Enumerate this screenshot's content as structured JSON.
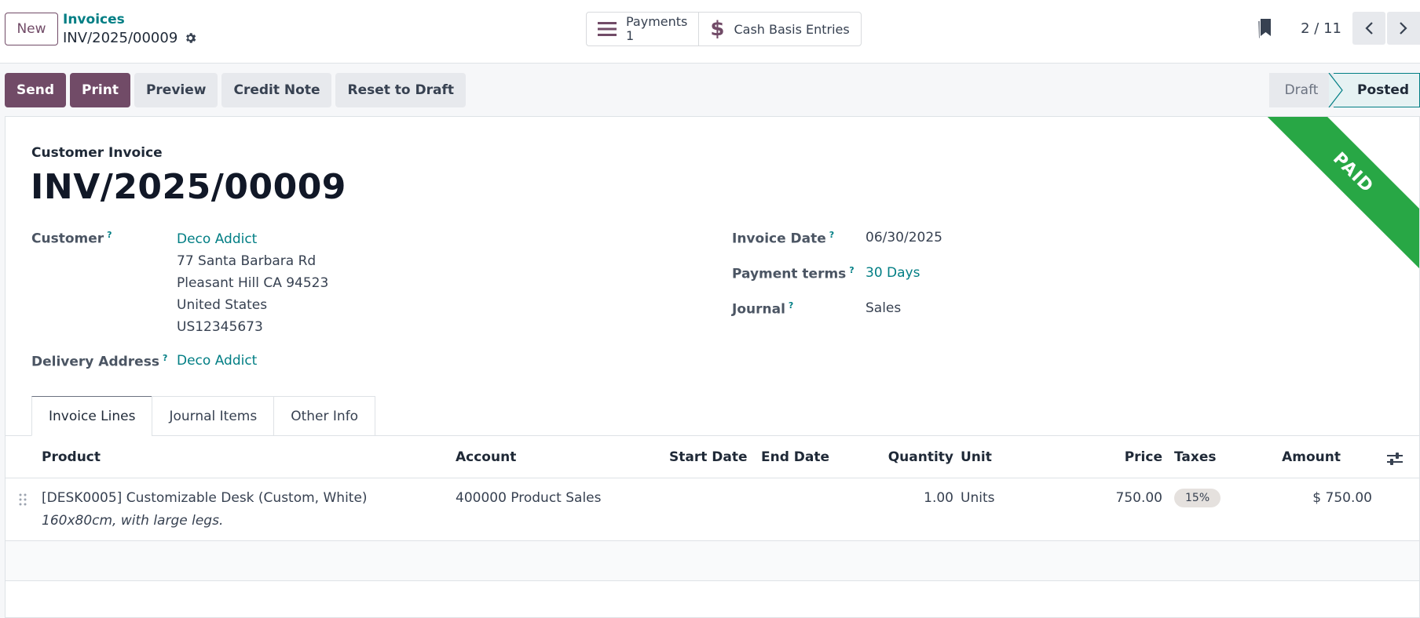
{
  "header": {
    "new_label": "New",
    "breadcrumb_parent": "Invoices",
    "breadcrumb_current": "INV/2025/00009",
    "smart_buttons": [
      {
        "icon": "bars-icon",
        "label": "Payments",
        "count": "1"
      },
      {
        "icon": "dollar-icon",
        "label": "Cash Basis Entries"
      }
    ],
    "pager_value": "2 / 11"
  },
  "actions": {
    "send": "Send",
    "print": "Print",
    "preview": "Preview",
    "credit_note": "Credit Note",
    "reset_to_draft": "Reset to Draft"
  },
  "status": {
    "steps": [
      "Draft",
      "Posted"
    ],
    "current": "Posted"
  },
  "ribbon": {
    "label": "PAID",
    "color": "#28a745"
  },
  "form": {
    "doc_type": "Customer Invoice",
    "doc_name": "INV/2025/00009",
    "customer_label": "Customer",
    "customer_name": "Deco Addict",
    "customer_address": [
      "77 Santa Barbara Rd",
      "Pleasant Hill CA 94523",
      "United States",
      "US12345673"
    ],
    "delivery_label": "Delivery Address",
    "delivery_value": "Deco Addict",
    "invoice_date_label": "Invoice Date",
    "invoice_date": "06/30/2025",
    "payment_terms_label": "Payment terms",
    "payment_terms": "30 Days",
    "journal_label": "Journal",
    "journal": "Sales",
    "help_mark": "?"
  },
  "tabs": [
    "Invoice Lines",
    "Journal Items",
    "Other Info"
  ],
  "lines": {
    "columns": {
      "product": "Product",
      "account": "Account",
      "start_date": "Start Date",
      "end_date": "End Date",
      "quantity": "Quantity",
      "unit": "Unit",
      "price": "Price",
      "taxes": "Taxes",
      "amount": "Amount"
    },
    "rows": [
      {
        "product": "[DESK0005] Customizable Desk (Custom, White)",
        "description": "160x80cm, with large legs.",
        "account": "400000 Product Sales",
        "start_date": "",
        "end_date": "",
        "quantity": "1.00",
        "unit": "Units",
        "price": "750.00",
        "taxes": "15%",
        "amount": "$ 750.00"
      }
    ]
  },
  "colors": {
    "brand": "#714b67",
    "link": "#017e84"
  }
}
